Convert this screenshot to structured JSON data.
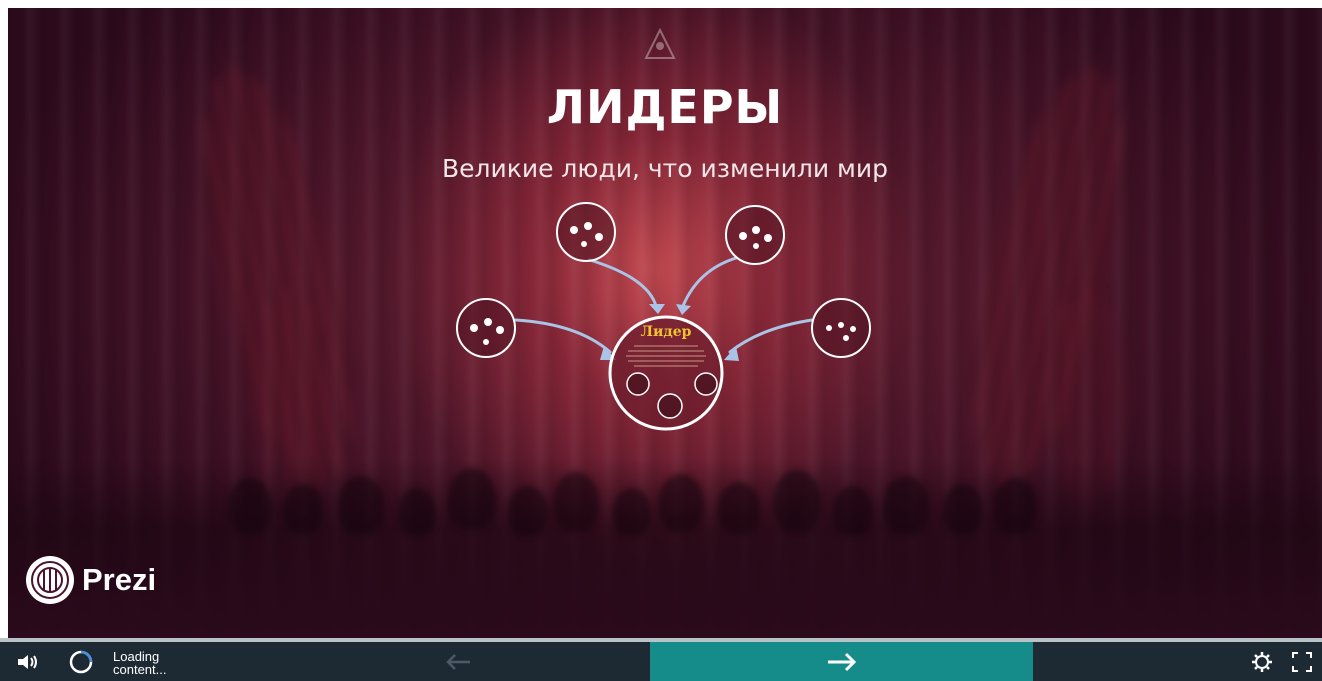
{
  "presentation": {
    "title": "ЛИДЕРЫ",
    "subtitle": "Великие люди, что изменили мир",
    "center_node_heading": "Лидер"
  },
  "branding": {
    "logo_text": "Prezi"
  },
  "controls": {
    "loading_line1": "Loading",
    "loading_line2": "content..."
  },
  "icons": {
    "volume": "speaker-icon",
    "spinner": "loading-spinner-icon",
    "prev": "arrow-left-icon",
    "next": "arrow-right-icon",
    "settings": "gear-icon",
    "fullscreen": "fullscreen-icon"
  },
  "colors": {
    "control_bar": "#1d2a33",
    "next_button": "#168c8a",
    "center_heading": "#f2c230",
    "arrow": "#aac4e8"
  }
}
